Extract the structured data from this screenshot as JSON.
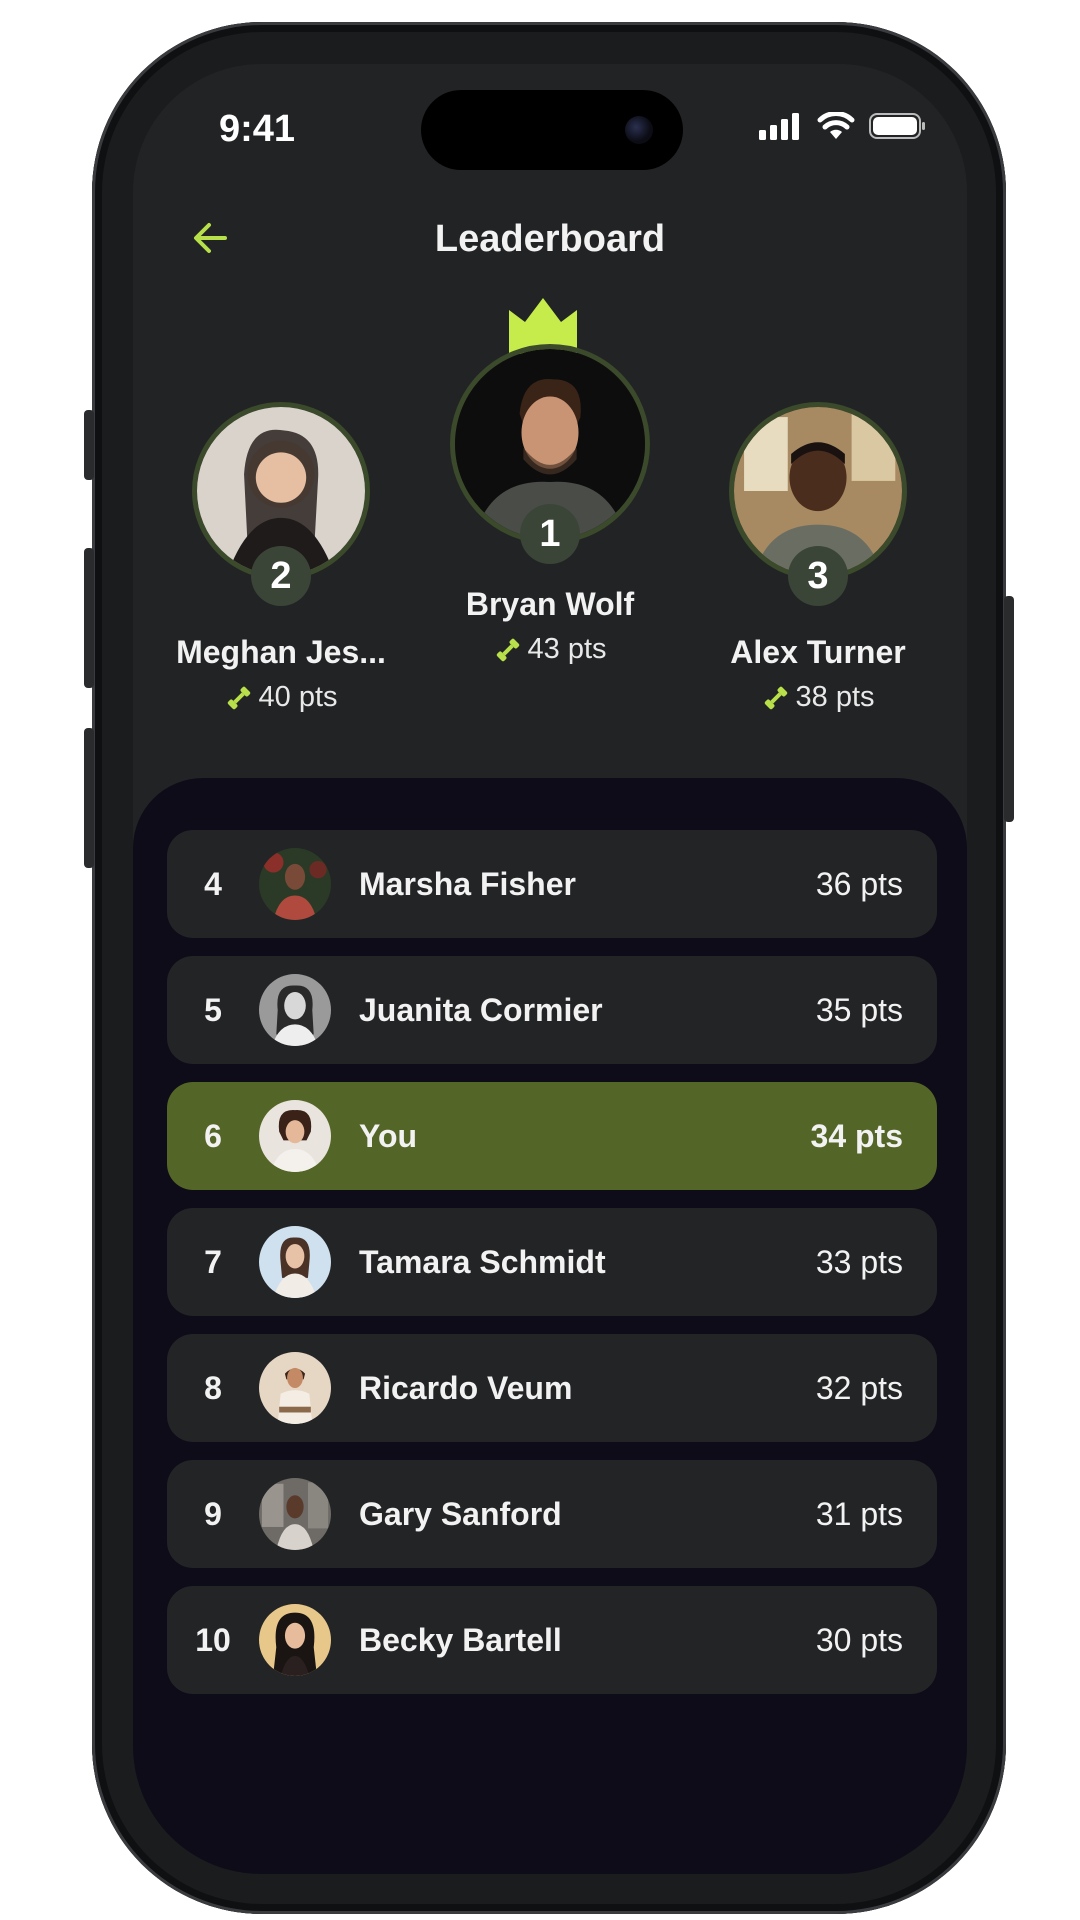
{
  "status": {
    "time": "9:41"
  },
  "header": {
    "title": "Leaderboard"
  },
  "podium": [
    {
      "rank": "2",
      "name": "Meghan Jes...",
      "points": "40 pts"
    },
    {
      "rank": "1",
      "name": "Bryan Wolf",
      "points": "43 pts"
    },
    {
      "rank": "3",
      "name": "Alex Turner",
      "points": "38 pts"
    }
  ],
  "list": [
    {
      "rank": "4",
      "name": "Marsha Fisher",
      "points": "36 pts"
    },
    {
      "rank": "5",
      "name": "Juanita Cormier",
      "points": "35 pts"
    },
    {
      "rank": "6",
      "name": "You",
      "points": "34 pts"
    },
    {
      "rank": "7",
      "name": "Tamara Schmidt",
      "points": "33 pts"
    },
    {
      "rank": "8",
      "name": "Ricardo Veum",
      "points": "32 pts"
    },
    {
      "rank": "9",
      "name": "Gary Sanford",
      "points": "31 pts"
    },
    {
      "rank": "10",
      "name": "Becky Bartell",
      "points": "30 pts"
    }
  ],
  "colors": {
    "accent": "#b8e04a",
    "highlight_row": "#536527",
    "panel": "#0d0c18",
    "background": "#222325"
  },
  "icons": {
    "back": "arrow-left-icon",
    "points": "dumbbell-icon",
    "leader": "crown-icon"
  }
}
